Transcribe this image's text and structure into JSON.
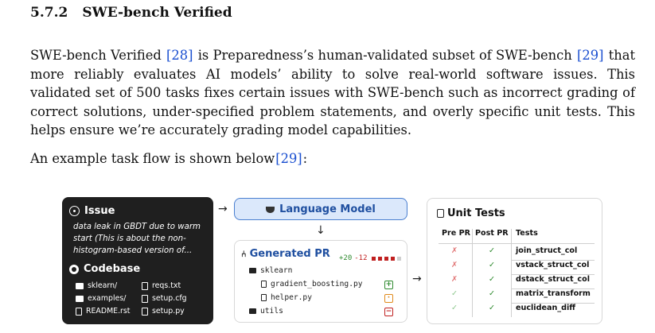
{
  "section": {
    "number": "5.7.2",
    "title": "SWE-bench Verified"
  },
  "paragraph1": {
    "part1": "SWE-bench Verified ",
    "cite1": "[28]",
    "part2": " is Preparedness’s human-validated subset of SWE-bench ",
    "cite2": "[29]",
    "part3": " that more reliably evaluates AI models’ ability to solve real-world software issues. This validated set of 500 tasks fixes certain issues with SWE-bench such as incorrect grading of correct solutions, under-specified problem statements, and overly specific unit tests. This helps ensure we’re accurately grading model capabilities."
  },
  "paragraph2": {
    "text": "An example task flow is shown below",
    "cite": "[29]",
    "suffix": ":"
  },
  "figure": {
    "issue": {
      "title": "Issue",
      "text": "data leak in GBDT due to warm start (This is about the non-histogram-based version of..."
    },
    "codebase": {
      "title": "Codebase",
      "files": [
        {
          "name": "sklearn/",
          "kind": "folder"
        },
        {
          "name": "reqs.txt",
          "kind": "file"
        },
        {
          "name": "examples/",
          "kind": "folder"
        },
        {
          "name": "setup.cfg",
          "kind": "file"
        },
        {
          "name": "README.rst",
          "kind": "file"
        },
        {
          "name": "setup.py",
          "kind": "file"
        }
      ]
    },
    "language_model": {
      "label": "Language Model"
    },
    "generated_pr": {
      "title": "Generated PR",
      "additions": "+20",
      "deletions": "-12",
      "tree": [
        {
          "name": "sklearn",
          "kind": "folder",
          "indent": 0
        },
        {
          "name": "gradient_boosting.py",
          "kind": "file",
          "indent": 1,
          "status": "added"
        },
        {
          "name": "helper.py",
          "kind": "file",
          "indent": 1,
          "status": "modified"
        },
        {
          "name": "utils",
          "kind": "folder",
          "indent": 0,
          "status": "removed"
        }
      ]
    },
    "unit_tests": {
      "title": "Unit Tests",
      "headers": [
        "Pre PR",
        "Post PR",
        "Tests"
      ],
      "rows": [
        {
          "pre": "✗",
          "post": "✓",
          "test": "join_struct_col"
        },
        {
          "pre": "✗",
          "post": "✓",
          "test": "vstack_struct_col"
        },
        {
          "pre": "✗",
          "post": "✓",
          "test": "dstack_struct_col"
        },
        {
          "pre": "✓",
          "post": "✓",
          "test": "matrix_transform"
        },
        {
          "pre": "✓",
          "post": "✓",
          "test": "euclidean_diff"
        }
      ]
    },
    "colors": {
      "card_dark": "#1f1f1f",
      "accent_blue": "#1f4fa0",
      "lm_fill": "#dbe8fb",
      "pass_green": "#2f8a2f",
      "pass_light": "#8fc98f",
      "fail_red": "#e07070",
      "add_green": "#2f8a2f",
      "mod_orange": "#e08a1a",
      "del_red": "#c02020"
    }
  }
}
